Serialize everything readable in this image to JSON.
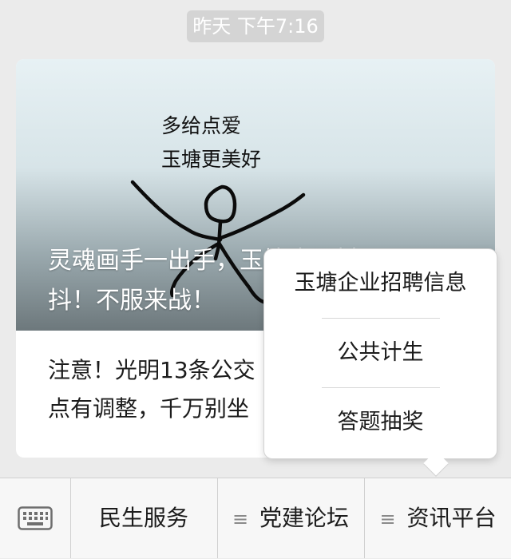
{
  "chat": {
    "timestamp": "昨天 下午7:16"
  },
  "article": {
    "hero_title": "灵魂画手一出手，玉塘也要抖三\n抖！不服来战！",
    "drawing_text_line1": "多给点爱",
    "drawing_text_line2": "玉塘更美好",
    "title": "注意！光明13条公交\n点有调整，千万别坐"
  },
  "popup_menu": {
    "items": [
      {
        "label": "玉塘企业招聘信息"
      },
      {
        "label": "公共计生"
      },
      {
        "label": "答题抽奖"
      }
    ]
  },
  "bottom_menu": {
    "keyboard_icon": "keyboard-icon",
    "tabs": [
      {
        "label": "民生服务",
        "icon": ""
      },
      {
        "label": "党建论坛",
        "icon": "menu-icon"
      },
      {
        "label": "资讯平台",
        "icon": "menu-icon"
      }
    ]
  }
}
